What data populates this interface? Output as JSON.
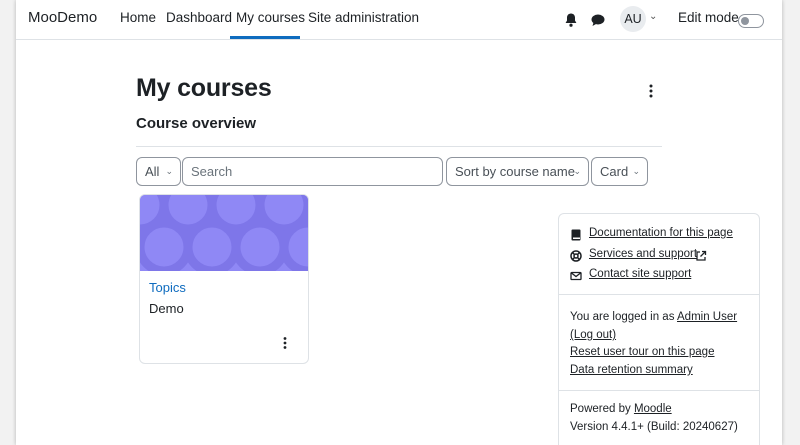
{
  "brand": "MooDemo",
  "nav": {
    "items": [
      {
        "label": "Home"
      },
      {
        "label": "Dashboard"
      },
      {
        "label": "My courses"
      },
      {
        "label": "Site administration"
      }
    ],
    "user_initials": "AU",
    "edit_mode_label": "Edit mode",
    "accent_color": "#0f6cbf"
  },
  "page": {
    "title": "My courses",
    "section_title": "Course overview"
  },
  "controls": {
    "filter_value": "All",
    "search_placeholder": "Search",
    "sort_value": "Sort by course name",
    "view_value": "Card"
  },
  "courses": [
    {
      "name": "Topics",
      "category": "Demo",
      "image_color": "#8f88f5"
    }
  ],
  "footer": {
    "links": {
      "documentation": "Documentation for this page",
      "services": "Services and support",
      "contact": "Contact site support"
    },
    "logged_in_prefix": "You are logged in as",
    "user_name": "Admin User",
    "logout": "(Log out)",
    "reset_tour": "Reset user tour on this page",
    "data_retention": "Data retention summary",
    "powered_by_prefix": "Powered by",
    "powered_by_link": "Moodle",
    "version": "Version 4.4.1+ (Build: 20240627)"
  },
  "icons": {
    "bell": "bell-icon",
    "chat": "chat-icon",
    "kebab": "kebab-icon",
    "book": "book-icon",
    "lifebuoy": "lifebuoy-icon",
    "envelope": "envelope-icon",
    "external": "external-link-icon"
  }
}
